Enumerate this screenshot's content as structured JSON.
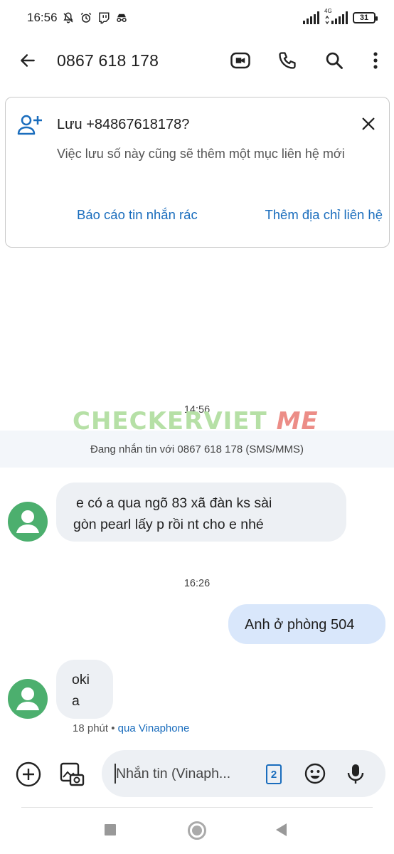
{
  "status_bar": {
    "time": "16:56",
    "network": "4G",
    "battery": "31",
    "icons": [
      "mute-icon",
      "alarm-icon",
      "twitch-icon",
      "incognito-icon",
      "signal-icon",
      "signal-4g-icon",
      "battery-icon"
    ]
  },
  "header": {
    "title": "0867 618 178",
    "icons": [
      "back-arrow-icon",
      "video-call-icon",
      "phone-icon",
      "search-icon",
      "more-vert-icon"
    ]
  },
  "save_card": {
    "title": "Lưu +84867618178?",
    "description": "Việc lưu số này cũng sẽ thêm một mục liên hệ mới",
    "report_spam": "Báo cáo tin nhắn rác",
    "add_contact": "Thêm địa chỉ liên hệ"
  },
  "watermark": {
    "main": "CHECKERVIET",
    "suffix": "ME"
  },
  "conversation": {
    "timestamp_1": "14:56",
    "info": "Đang nhắn tin với 0867 618 178 (SMS/MMS)",
    "message_1_line_1": "e có a qua ngõ 83 xã đàn ks sài",
    "message_1_line_2": "gòn pearl lấy p rồi nt cho e nhé",
    "timestamp_2": "16:26",
    "message_2": "Anh ở phòng 504",
    "message_3_line_1": "oki",
    "message_3_line_2": "a",
    "meta_time": "18 phút",
    "meta_via": "qua Vinaphone"
  },
  "composer": {
    "placeholder": "Nhắn tin (Vinaph...",
    "sim_slot": "2"
  },
  "colors": {
    "accent": "#1a6dbd",
    "avatar": "#4caf6e",
    "incoming_bubble": "#edf0f4",
    "outgoing_bubble": "#d9e7fb"
  }
}
